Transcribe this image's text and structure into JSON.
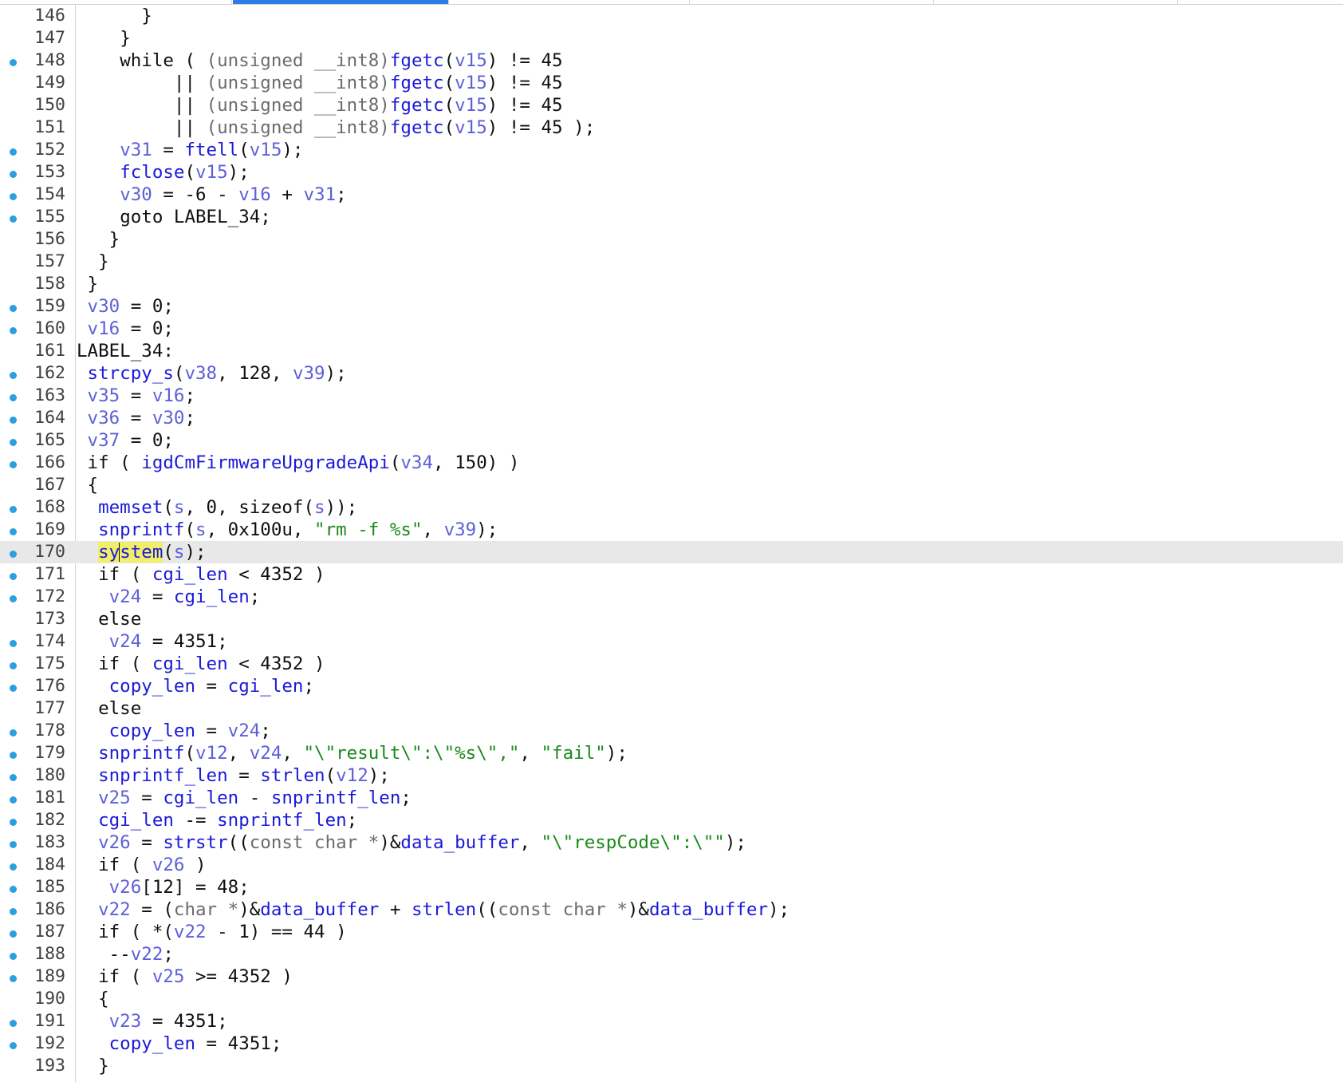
{
  "editor": {
    "line_numbers": [
      "146",
      "147",
      "148",
      "149",
      "150",
      "151",
      "152",
      "153",
      "154",
      "155",
      "156",
      "157",
      "158",
      "159",
      "160",
      "161",
      "162",
      "163",
      "164",
      "165",
      "166",
      "167",
      "168",
      "169",
      "170",
      "171",
      "172",
      "173",
      "174",
      "175",
      "176",
      "177",
      "178",
      "179",
      "180",
      "181",
      "182",
      "183",
      "184",
      "185",
      "186",
      "187",
      "188",
      "189",
      "190",
      "191",
      "192",
      "193"
    ],
    "breakpoint_marker_lines": [
      "148",
      "152",
      "153",
      "154",
      "155",
      "159",
      "160",
      "162",
      "163",
      "164",
      "165",
      "166",
      "168",
      "169",
      "170",
      "171",
      "172",
      "174",
      "175",
      "176",
      "178",
      "179",
      "180",
      "181",
      "182",
      "183",
      "184",
      "185",
      "186",
      "187",
      "188",
      "189",
      "191",
      "192"
    ],
    "current_line": "170",
    "highlighted_token": "system",
    "code": [
      [
        [
          "      ",
          "p"
        ],
        [
          "}",
          "p"
        ]
      ],
      [
        [
          "    ",
          "p"
        ],
        [
          "}",
          "p"
        ]
      ],
      [
        [
          "    ",
          "p"
        ],
        [
          "while",
          "kw"
        ],
        [
          " ( ",
          "p"
        ],
        [
          "(unsigned __int8)",
          "cast"
        ],
        [
          "fgetc",
          "fn"
        ],
        [
          "(",
          "p"
        ],
        [
          "v15",
          "var"
        ],
        [
          ") != 45",
          "p"
        ]
      ],
      [
        [
          "         || ",
          "p"
        ],
        [
          "(unsigned __int8)",
          "cast"
        ],
        [
          "fgetc",
          "fn"
        ],
        [
          "(",
          "p"
        ],
        [
          "v15",
          "var"
        ],
        [
          ") != 45",
          "p"
        ]
      ],
      [
        [
          "         || ",
          "p"
        ],
        [
          "(unsigned __int8)",
          "cast"
        ],
        [
          "fgetc",
          "fn"
        ],
        [
          "(",
          "p"
        ],
        [
          "v15",
          "var"
        ],
        [
          ") != 45",
          "p"
        ]
      ],
      [
        [
          "         || ",
          "p"
        ],
        [
          "(unsigned __int8)",
          "cast"
        ],
        [
          "fgetc",
          "fn"
        ],
        [
          "(",
          "p"
        ],
        [
          "v15",
          "var"
        ],
        [
          ") != 45 );",
          "p"
        ]
      ],
      [
        [
          "    ",
          "p"
        ],
        [
          "v31",
          "var"
        ],
        [
          " = ",
          "p"
        ],
        [
          "ftell",
          "fn"
        ],
        [
          "(",
          "p"
        ],
        [
          "v15",
          "var"
        ],
        [
          ");",
          "p"
        ]
      ],
      [
        [
          "    ",
          "p"
        ],
        [
          "fclose",
          "fn"
        ],
        [
          "(",
          "p"
        ],
        [
          "v15",
          "var"
        ],
        [
          ");",
          "p"
        ]
      ],
      [
        [
          "    ",
          "p"
        ],
        [
          "v30",
          "var"
        ],
        [
          " = -6 - ",
          "p"
        ],
        [
          "v16",
          "var"
        ],
        [
          " + ",
          "p"
        ],
        [
          "v31",
          "var"
        ],
        [
          ";",
          "p"
        ]
      ],
      [
        [
          "    ",
          "p"
        ],
        [
          "goto",
          "kw"
        ],
        [
          " LABEL_34;",
          "p"
        ]
      ],
      [
        [
          "   ",
          "p"
        ],
        [
          "}",
          "p"
        ]
      ],
      [
        [
          "  ",
          "p"
        ],
        [
          "}",
          "p"
        ]
      ],
      [
        [
          " ",
          "p"
        ],
        [
          "}",
          "p"
        ]
      ],
      [
        [
          " ",
          "p"
        ],
        [
          "v30",
          "var"
        ],
        [
          " = 0;",
          "p"
        ]
      ],
      [
        [
          " ",
          "p"
        ],
        [
          "v16",
          "var"
        ],
        [
          " = 0;",
          "p"
        ]
      ],
      [
        [
          "LABEL_34:",
          "p"
        ]
      ],
      [
        [
          " ",
          "p"
        ],
        [
          "strcpy_s",
          "fn"
        ],
        [
          "(",
          "p"
        ],
        [
          "v38",
          "var"
        ],
        [
          ", 128, ",
          "p"
        ],
        [
          "v39",
          "var"
        ],
        [
          ");",
          "p"
        ]
      ],
      [
        [
          " ",
          "p"
        ],
        [
          "v35",
          "var"
        ],
        [
          " = ",
          "p"
        ],
        [
          "v16",
          "var"
        ],
        [
          ";",
          "p"
        ]
      ],
      [
        [
          " ",
          "p"
        ],
        [
          "v36",
          "var"
        ],
        [
          " = ",
          "p"
        ],
        [
          "v30",
          "var"
        ],
        [
          ";",
          "p"
        ]
      ],
      [
        [
          " ",
          "p"
        ],
        [
          "v37",
          "var"
        ],
        [
          " = 0;",
          "p"
        ]
      ],
      [
        [
          " ",
          "p"
        ],
        [
          "if",
          "kw"
        ],
        [
          " ( ",
          "p"
        ],
        [
          "igdCmFirmwareUpgradeApi",
          "fn"
        ],
        [
          "(",
          "p"
        ],
        [
          "v34",
          "var"
        ],
        [
          ", 150) )",
          "p"
        ]
      ],
      [
        [
          " ",
          "p"
        ],
        [
          "{",
          "p"
        ]
      ],
      [
        [
          "  ",
          "p"
        ],
        [
          "memset",
          "fn"
        ],
        [
          "(",
          "p"
        ],
        [
          "s",
          "var"
        ],
        [
          ", 0, ",
          "p"
        ],
        [
          "sizeof",
          "kw"
        ],
        [
          "(",
          "p"
        ],
        [
          "s",
          "var"
        ],
        [
          "));",
          "p"
        ]
      ],
      [
        [
          "  ",
          "p"
        ],
        [
          "snprintf",
          "fn"
        ],
        [
          "(",
          "p"
        ],
        [
          "s",
          "var"
        ],
        [
          ", 0x100u, ",
          "p"
        ],
        [
          "\"rm -f %s\"",
          "str"
        ],
        [
          ", ",
          "p"
        ],
        [
          "v39",
          "var"
        ],
        [
          ");",
          "p"
        ]
      ],
      [
        [
          "  ",
          "p"
        ],
        [
          "sy",
          "hl"
        ],
        [
          "",
          "caret"
        ],
        [
          "stem",
          "hl"
        ],
        [
          "(",
          "p"
        ],
        [
          "s",
          "var"
        ],
        [
          ");",
          "p"
        ]
      ],
      [
        [
          "  ",
          "p"
        ],
        [
          "if",
          "kw"
        ],
        [
          " ( ",
          "p"
        ],
        [
          "cgi_len",
          "glob"
        ],
        [
          " < 4352 )",
          "p"
        ]
      ],
      [
        [
          "   ",
          "p"
        ],
        [
          "v24",
          "var"
        ],
        [
          " = ",
          "p"
        ],
        [
          "cgi_len",
          "glob"
        ],
        [
          ";",
          "p"
        ]
      ],
      [
        [
          "  ",
          "p"
        ],
        [
          "else",
          "kw"
        ]
      ],
      [
        [
          "   ",
          "p"
        ],
        [
          "v24",
          "var"
        ],
        [
          " = 4351;",
          "p"
        ]
      ],
      [
        [
          "  ",
          "p"
        ],
        [
          "if",
          "kw"
        ],
        [
          " ( ",
          "p"
        ],
        [
          "cgi_len",
          "glob"
        ],
        [
          " < 4352 )",
          "p"
        ]
      ],
      [
        [
          "   ",
          "p"
        ],
        [
          "copy_len",
          "glob"
        ],
        [
          " = ",
          "p"
        ],
        [
          "cgi_len",
          "glob"
        ],
        [
          ";",
          "p"
        ]
      ],
      [
        [
          "  ",
          "p"
        ],
        [
          "else",
          "kw"
        ]
      ],
      [
        [
          "   ",
          "p"
        ],
        [
          "copy_len",
          "glob"
        ],
        [
          " = ",
          "p"
        ],
        [
          "v24",
          "var"
        ],
        [
          ";",
          "p"
        ]
      ],
      [
        [
          "  ",
          "p"
        ],
        [
          "snprintf",
          "fn"
        ],
        [
          "(",
          "p"
        ],
        [
          "v12",
          "var"
        ],
        [
          ", ",
          "p"
        ],
        [
          "v24",
          "var"
        ],
        [
          ", ",
          "p"
        ],
        [
          "\"\\\"result\\\":\\\"%s\\\",\"",
          "str"
        ],
        [
          ", ",
          "p"
        ],
        [
          "\"fail\"",
          "str"
        ],
        [
          ");",
          "p"
        ]
      ],
      [
        [
          "  ",
          "p"
        ],
        [
          "snprintf_len",
          "glob"
        ],
        [
          " = ",
          "p"
        ],
        [
          "strlen",
          "fn"
        ],
        [
          "(",
          "p"
        ],
        [
          "v12",
          "var"
        ],
        [
          ");",
          "p"
        ]
      ],
      [
        [
          "  ",
          "p"
        ],
        [
          "v25",
          "var"
        ],
        [
          " = ",
          "p"
        ],
        [
          "cgi_len",
          "glob"
        ],
        [
          " - ",
          "p"
        ],
        [
          "snprintf_len",
          "glob"
        ],
        [
          ";",
          "p"
        ]
      ],
      [
        [
          "  ",
          "p"
        ],
        [
          "cgi_len",
          "glob"
        ],
        [
          " -= ",
          "p"
        ],
        [
          "snprintf_len",
          "glob"
        ],
        [
          ";",
          "p"
        ]
      ],
      [
        [
          "  ",
          "p"
        ],
        [
          "v26",
          "var"
        ],
        [
          " = ",
          "p"
        ],
        [
          "strstr",
          "fn"
        ],
        [
          "((",
          "p"
        ],
        [
          "const char *",
          "cast"
        ],
        [
          ")&",
          "p"
        ],
        [
          "data_buffer",
          "glob"
        ],
        [
          ", ",
          "p"
        ],
        [
          "\"\\\"respCode\\\":\\\"\"",
          "str"
        ],
        [
          ");",
          "p"
        ]
      ],
      [
        [
          "  ",
          "p"
        ],
        [
          "if",
          "kw"
        ],
        [
          " ( ",
          "p"
        ],
        [
          "v26",
          "var"
        ],
        [
          " )",
          "p"
        ]
      ],
      [
        [
          "   ",
          "p"
        ],
        [
          "v26",
          "var"
        ],
        [
          "[12] = 48;",
          "p"
        ]
      ],
      [
        [
          "  ",
          "p"
        ],
        [
          "v22",
          "var"
        ],
        [
          " = (",
          "p"
        ],
        [
          "char *",
          "cast"
        ],
        [
          ")&",
          "p"
        ],
        [
          "data_buffer",
          "glob"
        ],
        [
          " + ",
          "p"
        ],
        [
          "strlen",
          "fn"
        ],
        [
          "((",
          "p"
        ],
        [
          "const char *",
          "cast"
        ],
        [
          ")&",
          "p"
        ],
        [
          "data_buffer",
          "glob"
        ],
        [
          ");",
          "p"
        ]
      ],
      [
        [
          "  ",
          "p"
        ],
        [
          "if",
          "kw"
        ],
        [
          " ( *(",
          "p"
        ],
        [
          "v22",
          "var"
        ],
        [
          " - 1) == 44 )",
          "p"
        ]
      ],
      [
        [
          "   --",
          "p"
        ],
        [
          "v22",
          "var"
        ],
        [
          ";",
          "p"
        ]
      ],
      [
        [
          "  ",
          "p"
        ],
        [
          "if",
          "kw"
        ],
        [
          " ( ",
          "p"
        ],
        [
          "v25",
          "var"
        ],
        [
          " >= 4352 )",
          "p"
        ]
      ],
      [
        [
          "  ",
          "p"
        ],
        [
          "{",
          "p"
        ]
      ],
      [
        [
          "   ",
          "p"
        ],
        [
          "v23",
          "var"
        ],
        [
          " = 4351;",
          "p"
        ]
      ],
      [
        [
          "   ",
          "p"
        ],
        [
          "copy_len",
          "glob"
        ],
        [
          " = 4351;",
          "p"
        ]
      ],
      [
        [
          "  ",
          "p"
        ],
        [
          "}",
          "p"
        ]
      ]
    ]
  },
  "colors": {
    "function": "#1a1ad8",
    "local_variable": "#5f5fd9",
    "string": "#1a8a1a",
    "cast": "#6c6c6c",
    "text": "#101010",
    "marker": "#2aa0e0",
    "current_line_bg": "#e8e8e8",
    "search_highlight": "#f0ee6a",
    "active_tab": "#2d7fe6"
  },
  "icons": {
    "line_marker": "breakpoint-dot-icon"
  }
}
